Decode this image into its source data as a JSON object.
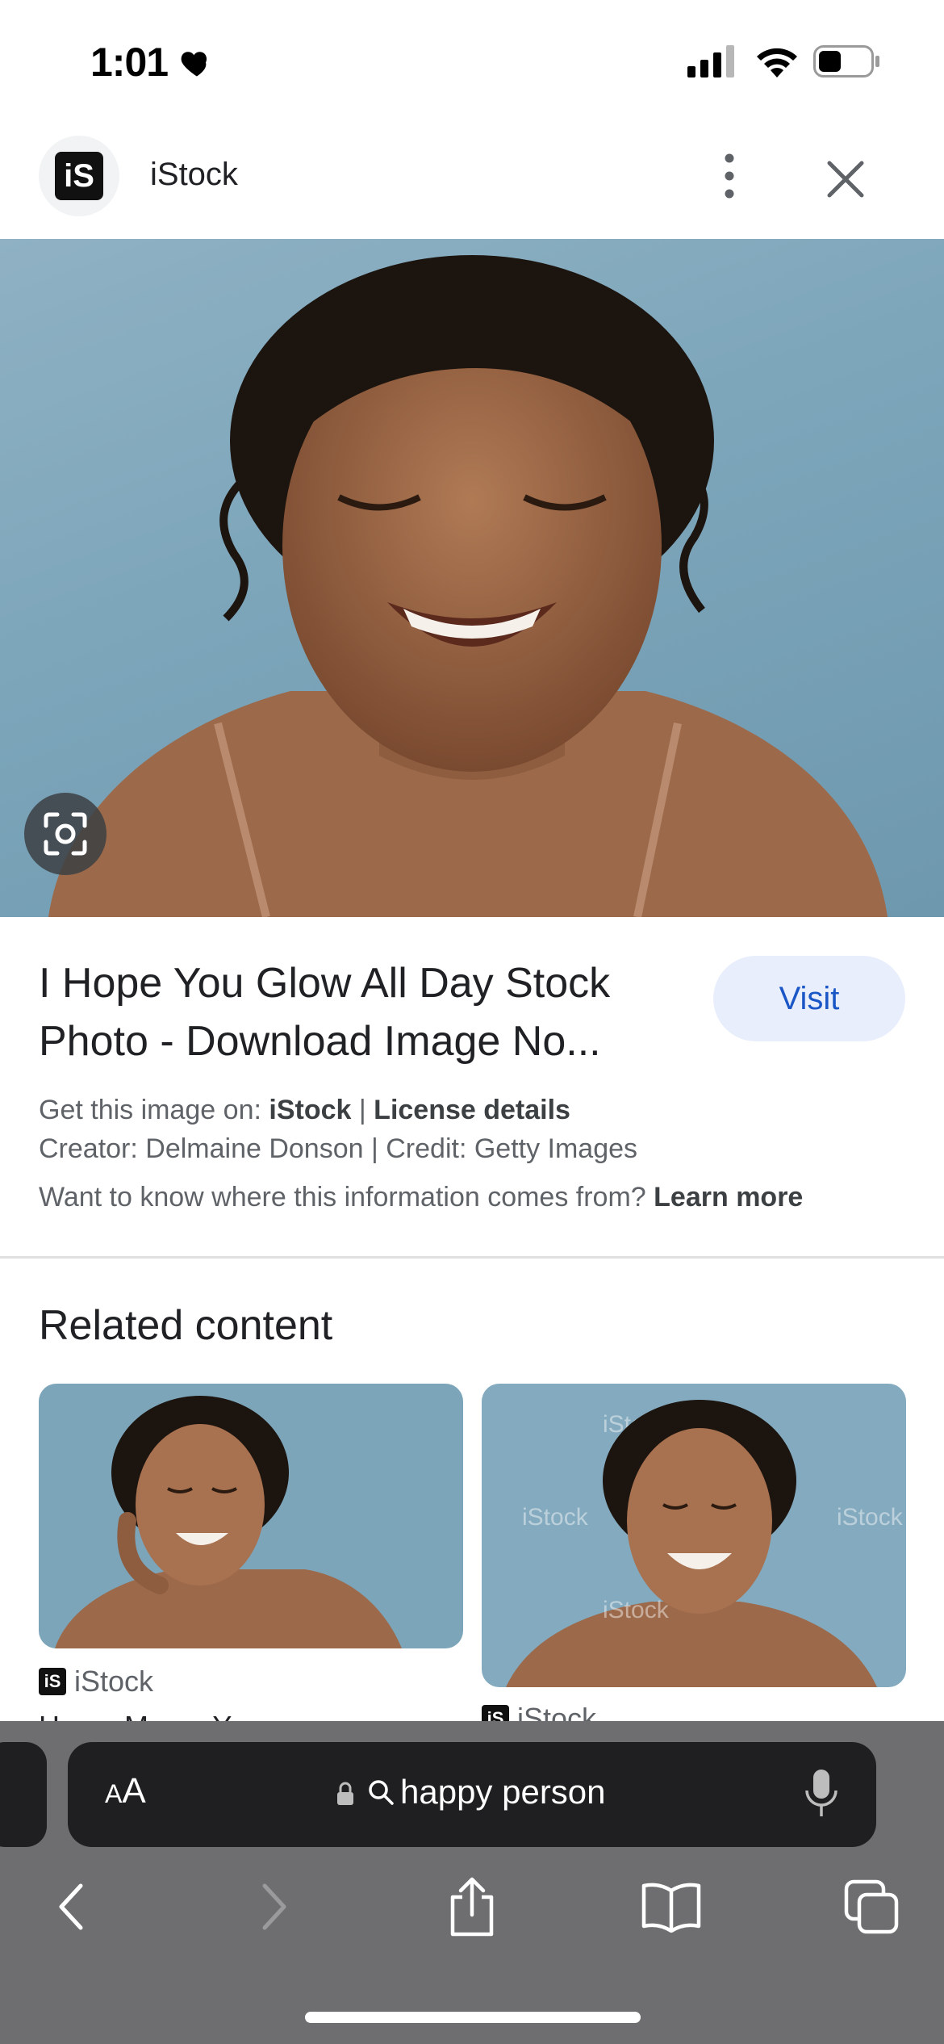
{
  "status_bar": {
    "time": "1:01",
    "heart_icon": "heart-icon",
    "battery_level": 0.45
  },
  "header": {
    "site_name": "iStock",
    "logo_text": "iS"
  },
  "result": {
    "title": "I Hope You Glow All Day Stock Photo - Download Image No...",
    "visit_label": "Visit",
    "get_image_prefix": "Get this image on:",
    "get_image_source": "iStock",
    "separator": "|",
    "license_label": "License details",
    "creator_line": "Creator: Delmaine Donson | Credit: Getty Images",
    "info_question": "Want to know where this information comes from?",
    "learn_more": "Learn more"
  },
  "related": {
    "heading": "Related content",
    "items": [
      {
        "source": "iStock",
        "title_peek": "H... ... M... ... Y..."
      },
      {
        "source": "iStock"
      }
    ],
    "watermark": "iStock"
  },
  "browser": {
    "aa_label_small": "A",
    "aa_label_large": "A",
    "query": "happy person"
  },
  "colors": {
    "accent": "#1a56c5",
    "visit_bg": "#e8eefc",
    "toolbar_bg": "#6e6e70",
    "address_bg": "#1f1f21",
    "photo_bg": "#7ca5ba"
  }
}
